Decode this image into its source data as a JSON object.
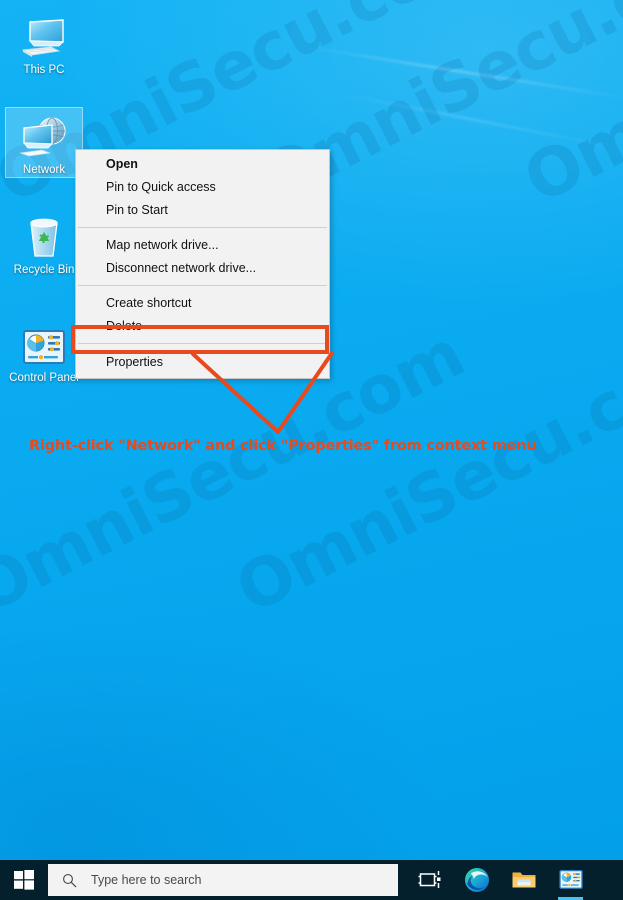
{
  "desktop": {
    "background_color": "#0aaef2",
    "icons": [
      {
        "label": "This PC",
        "icon": "this-pc-icon",
        "selected": false
      },
      {
        "label": "Network",
        "icon": "network-icon",
        "selected": true
      },
      {
        "label": "Recycle Bin",
        "icon": "recycle-bin-icon",
        "selected": false
      },
      {
        "label": "Control Panel",
        "icon": "control-panel-icon",
        "selected": false
      }
    ]
  },
  "watermark": {
    "text": "OmniSecu.com",
    "color": "#0a5f96"
  },
  "context_menu": {
    "items": [
      {
        "label": "Open",
        "bold": true,
        "separator_after": false
      },
      {
        "label": "Pin to Quick access",
        "bold": false,
        "separator_after": false
      },
      {
        "label": "Pin to Start",
        "bold": false,
        "separator_after": true
      },
      {
        "label": "Map network drive...",
        "bold": false,
        "separator_after": false
      },
      {
        "label": "Disconnect network drive...",
        "bold": false,
        "separator_after": true
      },
      {
        "label": "Create shortcut",
        "bold": false,
        "separator_after": false
      },
      {
        "label": "Delete",
        "bold": false,
        "separator_after": true
      },
      {
        "label": "Properties",
        "bold": false,
        "separator_after": false,
        "highlighted": true
      }
    ]
  },
  "annotation": {
    "text": "Right-click \"Network\" and click \"Properties\" from context menu",
    "color": "#e8491d"
  },
  "taskbar": {
    "background_color": "#04202c",
    "start_label": "Start",
    "search": {
      "placeholder": "Type here to search",
      "value": "Type here to search"
    },
    "buttons": [
      {
        "name": "task-view",
        "label": "Task View"
      },
      {
        "name": "microsoft-edge",
        "label": "Microsoft Edge"
      },
      {
        "name": "file-explorer",
        "label": "File Explorer"
      },
      {
        "name": "control-panel",
        "label": "Control Panel"
      }
    ]
  }
}
